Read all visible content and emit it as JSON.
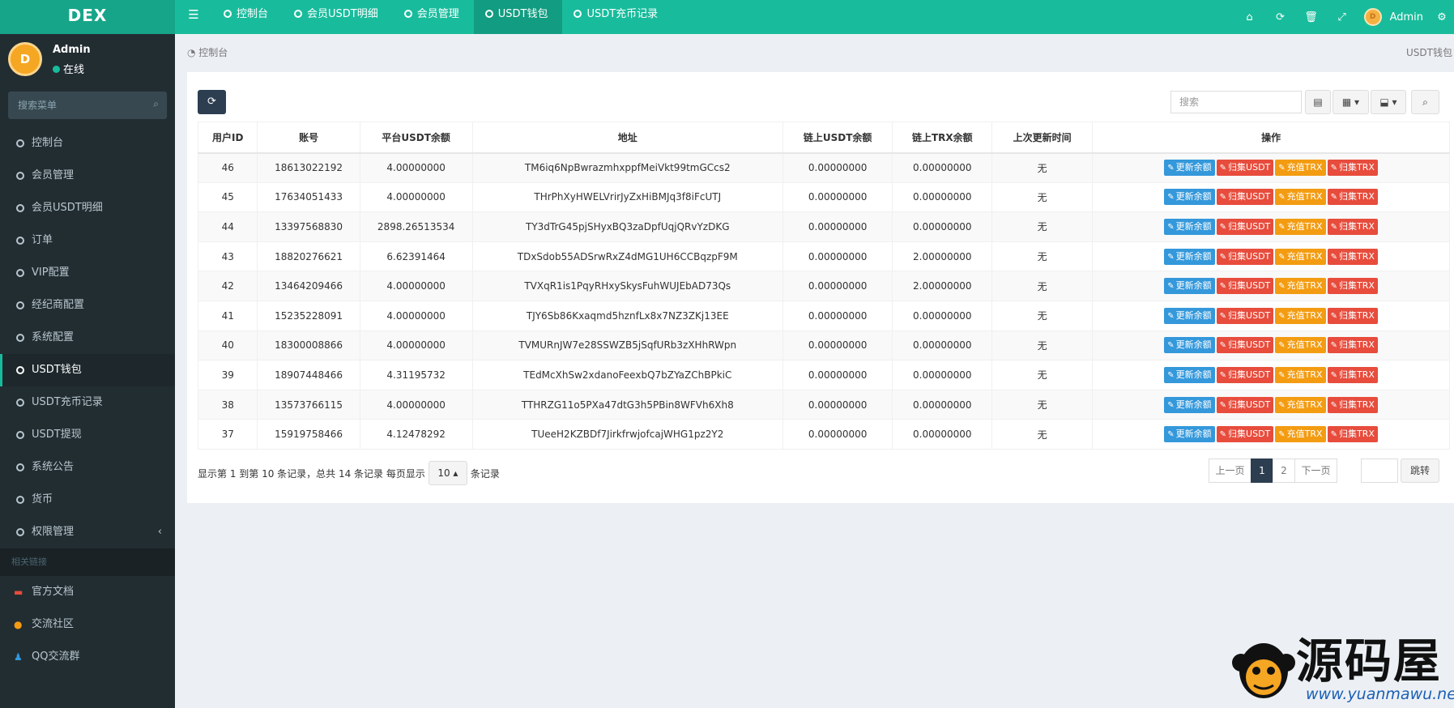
{
  "app": {
    "logo": "DEX",
    "username": "Admin",
    "status": "在线"
  },
  "topbar": {
    "tabs": [
      {
        "label": "控制台",
        "active": false
      },
      {
        "label": "会员USDT明细",
        "active": false
      },
      {
        "label": "会员管理",
        "active": false
      },
      {
        "label": "USDT钱包",
        "active": true
      },
      {
        "label": "USDT充币记录",
        "active": false
      }
    ],
    "icons": [
      "home-icon",
      "refresh-icon",
      "trash-icon",
      "fullscreen-icon",
      "settings-icon"
    ],
    "user": "Admin"
  },
  "sidebar": {
    "search_placeholder": "搜索菜单",
    "items": [
      {
        "label": "控制台"
      },
      {
        "label": "会员管理"
      },
      {
        "label": "会员USDT明细"
      },
      {
        "label": "订单"
      },
      {
        "label": "VIP配置"
      },
      {
        "label": "经纪商配置"
      },
      {
        "label": "系统配置"
      },
      {
        "label": "USDT钱包",
        "active": true
      },
      {
        "label": "USDT充币记录"
      },
      {
        "label": "USDT提现"
      },
      {
        "label": "系统公告"
      },
      {
        "label": "货币"
      },
      {
        "label": "权限管理",
        "chevron": "‹"
      }
    ],
    "links_header": "相关链接",
    "links": [
      {
        "label": "官方文档",
        "icon": "book-icon",
        "color": "#e74c3c"
      },
      {
        "label": "交流社区",
        "icon": "comment-icon",
        "color": "#f39c12"
      },
      {
        "label": "QQ交流群",
        "icon": "qq-icon",
        "color": "#3498db"
      }
    ]
  },
  "breadcrumb": {
    "home": "控制台",
    "current": "USDT钱包"
  },
  "toolbar": {
    "search_placeholder": "搜索"
  },
  "table": {
    "columns": [
      "用户ID",
      "账号",
      "平台USDT余额",
      "地址",
      "链上USDT余额",
      "链上TRX余额",
      "上次更新时间",
      "操作"
    ],
    "actions": [
      {
        "label": "更新余额",
        "color": "#3498db"
      },
      {
        "label": "归集USDT",
        "color": "#e74c3c"
      },
      {
        "label": "充值TRX",
        "color": "#f39c12"
      },
      {
        "label": "归集TRX",
        "color": "#e74c3c"
      }
    ],
    "rows": [
      {
        "id": "46",
        "account": "18613022192",
        "balance": "4.00000000",
        "address": "TM6iq6NpBwrazmhxppfMeiVkt99tmGCcs2",
        "chain_usdt": "0.00000000",
        "chain_trx": "0.00000000",
        "updated": "无"
      },
      {
        "id": "45",
        "account": "17634051433",
        "balance": "4.00000000",
        "address": "THrPhXyHWELVrirJyZxHiBMJq3f8iFcUTJ",
        "chain_usdt": "0.00000000",
        "chain_trx": "0.00000000",
        "updated": "无"
      },
      {
        "id": "44",
        "account": "13397568830",
        "balance": "2898.26513534",
        "address": "TY3dTrG45pjSHyxBQ3zaDpfUqjQRvYzDKG",
        "chain_usdt": "0.00000000",
        "chain_trx": "0.00000000",
        "updated": "无"
      },
      {
        "id": "43",
        "account": "18820276621",
        "balance": "6.62391464",
        "address": "TDxSdob55ADSrwRxZ4dMG1UH6CCBqzpF9M",
        "chain_usdt": "0.00000000",
        "chain_trx": "2.00000000",
        "updated": "无"
      },
      {
        "id": "42",
        "account": "13464209466",
        "balance": "4.00000000",
        "address": "TVXqR1is1PqyRHxySkysFuhWUJEbAD73Qs",
        "chain_usdt": "0.00000000",
        "chain_trx": "2.00000000",
        "updated": "无"
      },
      {
        "id": "41",
        "account": "15235228091",
        "balance": "4.00000000",
        "address": "TJY6Sb86Kxaqmd5hznfLx8x7NZ3ZKj13EE",
        "chain_usdt": "0.00000000",
        "chain_trx": "0.00000000",
        "updated": "无"
      },
      {
        "id": "40",
        "account": "18300008866",
        "balance": "4.00000000",
        "address": "TVMURnJW7e28SSWZB5jSqfURb3zXHhRWpn",
        "chain_usdt": "0.00000000",
        "chain_trx": "0.00000000",
        "updated": "无"
      },
      {
        "id": "39",
        "account": "18907448466",
        "balance": "4.31195732",
        "address": "TEdMcXhSw2xdanoFeexbQ7bZYaZChBPkiC",
        "chain_usdt": "0.00000000",
        "chain_trx": "0.00000000",
        "updated": "无"
      },
      {
        "id": "38",
        "account": "13573766115",
        "balance": "4.00000000",
        "address": "TTHRZG11o5PXa47dtG3h5PBin8WFVh6Xh8",
        "chain_usdt": "0.00000000",
        "chain_trx": "0.00000000",
        "updated": "无"
      },
      {
        "id": "37",
        "account": "15919758466",
        "balance": "4.12478292",
        "address": "TUeeH2KZBDf7JirkfrwjofcajWHG1pz2Y2",
        "chain_usdt": "0.00000000",
        "chain_trx": "0.00000000",
        "updated": "无"
      }
    ]
  },
  "pagination": {
    "info_prefix": "显示第 1 到第 10 条记录，总共 14 条记录 每页显示",
    "page_size": "10",
    "info_suffix": "条记录",
    "prev": "上一页",
    "pages": [
      "1",
      "2"
    ],
    "current_page": "1",
    "next": "下一页",
    "jump": "跳转"
  },
  "watermark": {
    "text": "源码屋",
    "url": "www.yuanmawu.net"
  },
  "colors": {
    "accent": "#18bc9c",
    "sidebar_bg": "#222d32",
    "dark_button": "#2c3e50"
  }
}
